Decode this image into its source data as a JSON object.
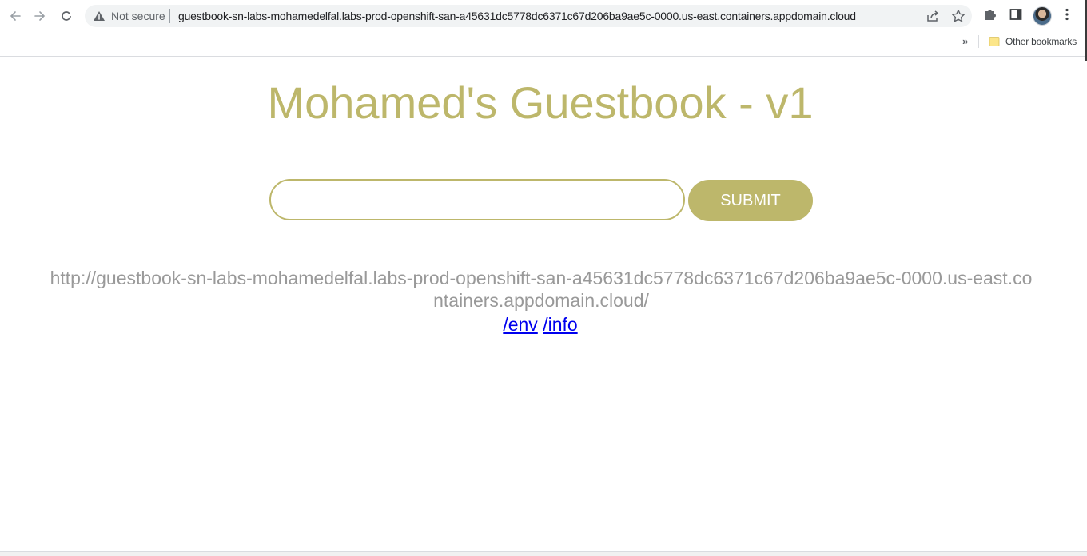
{
  "browser": {
    "back_icon": "arrow-left-icon",
    "forward_icon": "arrow-right-icon",
    "reload_icon": "reload-icon",
    "security_label": "Not secure",
    "url": "guestbook-sn-labs-mohamedelfal.labs-prod-openshift-san-a45631dc5778dc6371c67d206ba9ae5c-0000.us-east.containers.appdomain.cloud",
    "share_icon": "share-icon",
    "bookmark_star_icon": "star-icon",
    "extensions_icon": "puzzle-icon",
    "side_panel_icon": "side-panel-icon",
    "menu_icon": "kebab-menu-icon",
    "bookmarks_bar": {
      "overflow_label": "»",
      "other_bookmarks_label": "Other bookmarks"
    }
  },
  "page": {
    "title": "Mohamed's Guestbook - v1",
    "entry_placeholder": "",
    "submit_label": "SUBMIT",
    "host_address": "http://guestbook-sn-labs-mohamedelfal.labs-prod-openshift-san-a45631dc5778dc6371c67d206ba9ae5c-0000.us-east.containers.appdomain.cloud/",
    "links": [
      {
        "label": "/env"
      },
      {
        "label": "/info"
      }
    ]
  },
  "colors": {
    "accent": "#bdb76b",
    "address_text": "#999999",
    "link": "#0000ee"
  }
}
